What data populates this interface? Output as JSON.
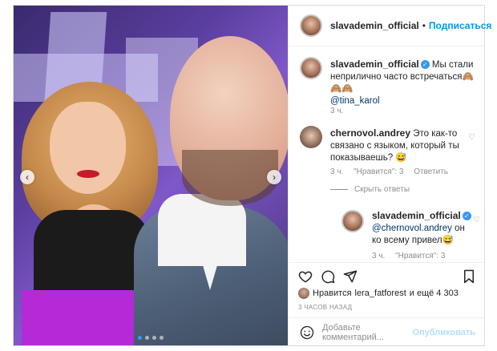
{
  "post": {
    "username": "slavademin_official",
    "follow_label": "Подписаться"
  },
  "caption": {
    "username": "slavademin_official",
    "text": "Мы стали неприлично часто встречаться",
    "emojis": "🙈🙈🙈",
    "mention": "@tina_karol",
    "time": "3 ч."
  },
  "comment": {
    "username": "chernovol.andrey",
    "text": "Это как-то связано с языком, который ты показываешь?",
    "emoji": "😅",
    "time": "3 ч.",
    "likes": "\"Нравится\": 3",
    "reply_label": "Ответить",
    "hide_replies": "Скрыть ответы"
  },
  "reply": {
    "username": "slavademin_official",
    "mention": "@chernovol.andrey",
    "text": "он ко всему привел",
    "emoji": "😅",
    "time": "3 ч.",
    "likes": "\"Нравится\": 3"
  },
  "likes": {
    "prefix": "Нравится",
    "user": "lera_fatforest",
    "suffix": "и ещё 4 303"
  },
  "date": "3 ЧАСОВ НАЗАД",
  "add_comment": {
    "placeholder": "Добавьте комментарий...",
    "publish": "Опубликовать"
  },
  "carousel": {
    "total": 4,
    "current": 1
  },
  "colors": {
    "accent": "#0095f6",
    "muted": "#8e8e8e",
    "border": "#dbdbdb"
  }
}
